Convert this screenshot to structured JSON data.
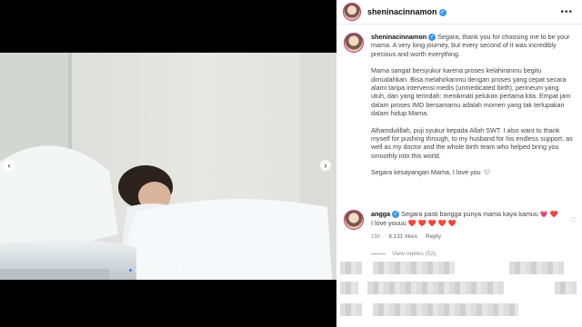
{
  "post": {
    "username": "sheninacinnamon",
    "carousel_total": 10,
    "carousel_active": 0
  },
  "caption": {
    "username": "sheninacinnamon",
    "paragraphs": [
      "Segara, thank you for choosing me to be your mama. A very long journey, but every second of it was incredibly precious and worth everything.",
      "Mama sangat bersyukur karena proses kelahiranmu begitu dimudahkan. Bisa melahirkanmu dengan proses yang cepat secara alami tanpa intervensi medis (unmedicated birth), perineum yang utuh, dan yang terindah: menikmati pelukan pertama kita. Empat jam dalam proses IMD bersamamu adalah momen yang tak terlupakan dalam hidup Mama.",
      "Alhamdulillah, puji syukur kepada Allah SWT. I also want to thank myself for pushing through, to my husband for his endless support, as well as my doctor and the whole birth team who helped bring you smoothly into this world.",
      "Segara kesayangan Mama, I love you 🤍"
    ]
  },
  "comment": {
    "username": "angga",
    "text": "Segara pasti bangga punya mama kaya kamuu",
    "emoji_after_text": "💗 ❤️",
    "line2": "I love youuu",
    "hearts": "❤️ ❤️ ❤️ ❤️ ❤️",
    "time": "15h",
    "likes": "6.131 likes",
    "reply": "Reply",
    "view_replies": "View replies (52)"
  },
  "icons": {
    "more": "more-horizontal-icon",
    "prev": "chevron-left-icon",
    "next": "chevron-right-icon",
    "verified": "verified-badge-icon",
    "like": "heart-outline-icon"
  },
  "colors": {
    "verified": "#3897f0",
    "active_dot": "#2a7fff",
    "heart": "#e1245a"
  }
}
